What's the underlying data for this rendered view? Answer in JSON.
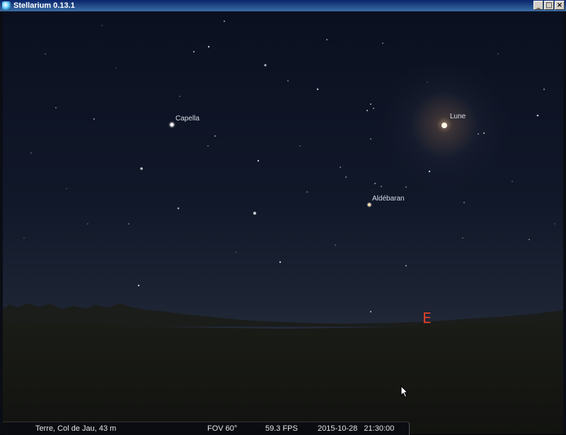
{
  "window": {
    "title": "Stellarium 0.13.1",
    "minimize_label": "_",
    "maximize_label": "□",
    "close_label": "×"
  },
  "sky_labels": {
    "capella": "Capella",
    "lune": "Lune",
    "aldebaran": "Aldébaran",
    "cardinal_east": "E"
  },
  "statusbar": {
    "location": "Terre, Col de Jau, 43 m",
    "fov": "FOV 60°",
    "fps": "59.3 FPS",
    "datetime": "2015-10-28   21:30:00"
  },
  "colors": {
    "sky_top": "#0b1020",
    "sky_horizon": "#1f2636",
    "ground": "#151612",
    "cardinal": "#e0402a",
    "moon_glow": "#ffcf9a"
  }
}
